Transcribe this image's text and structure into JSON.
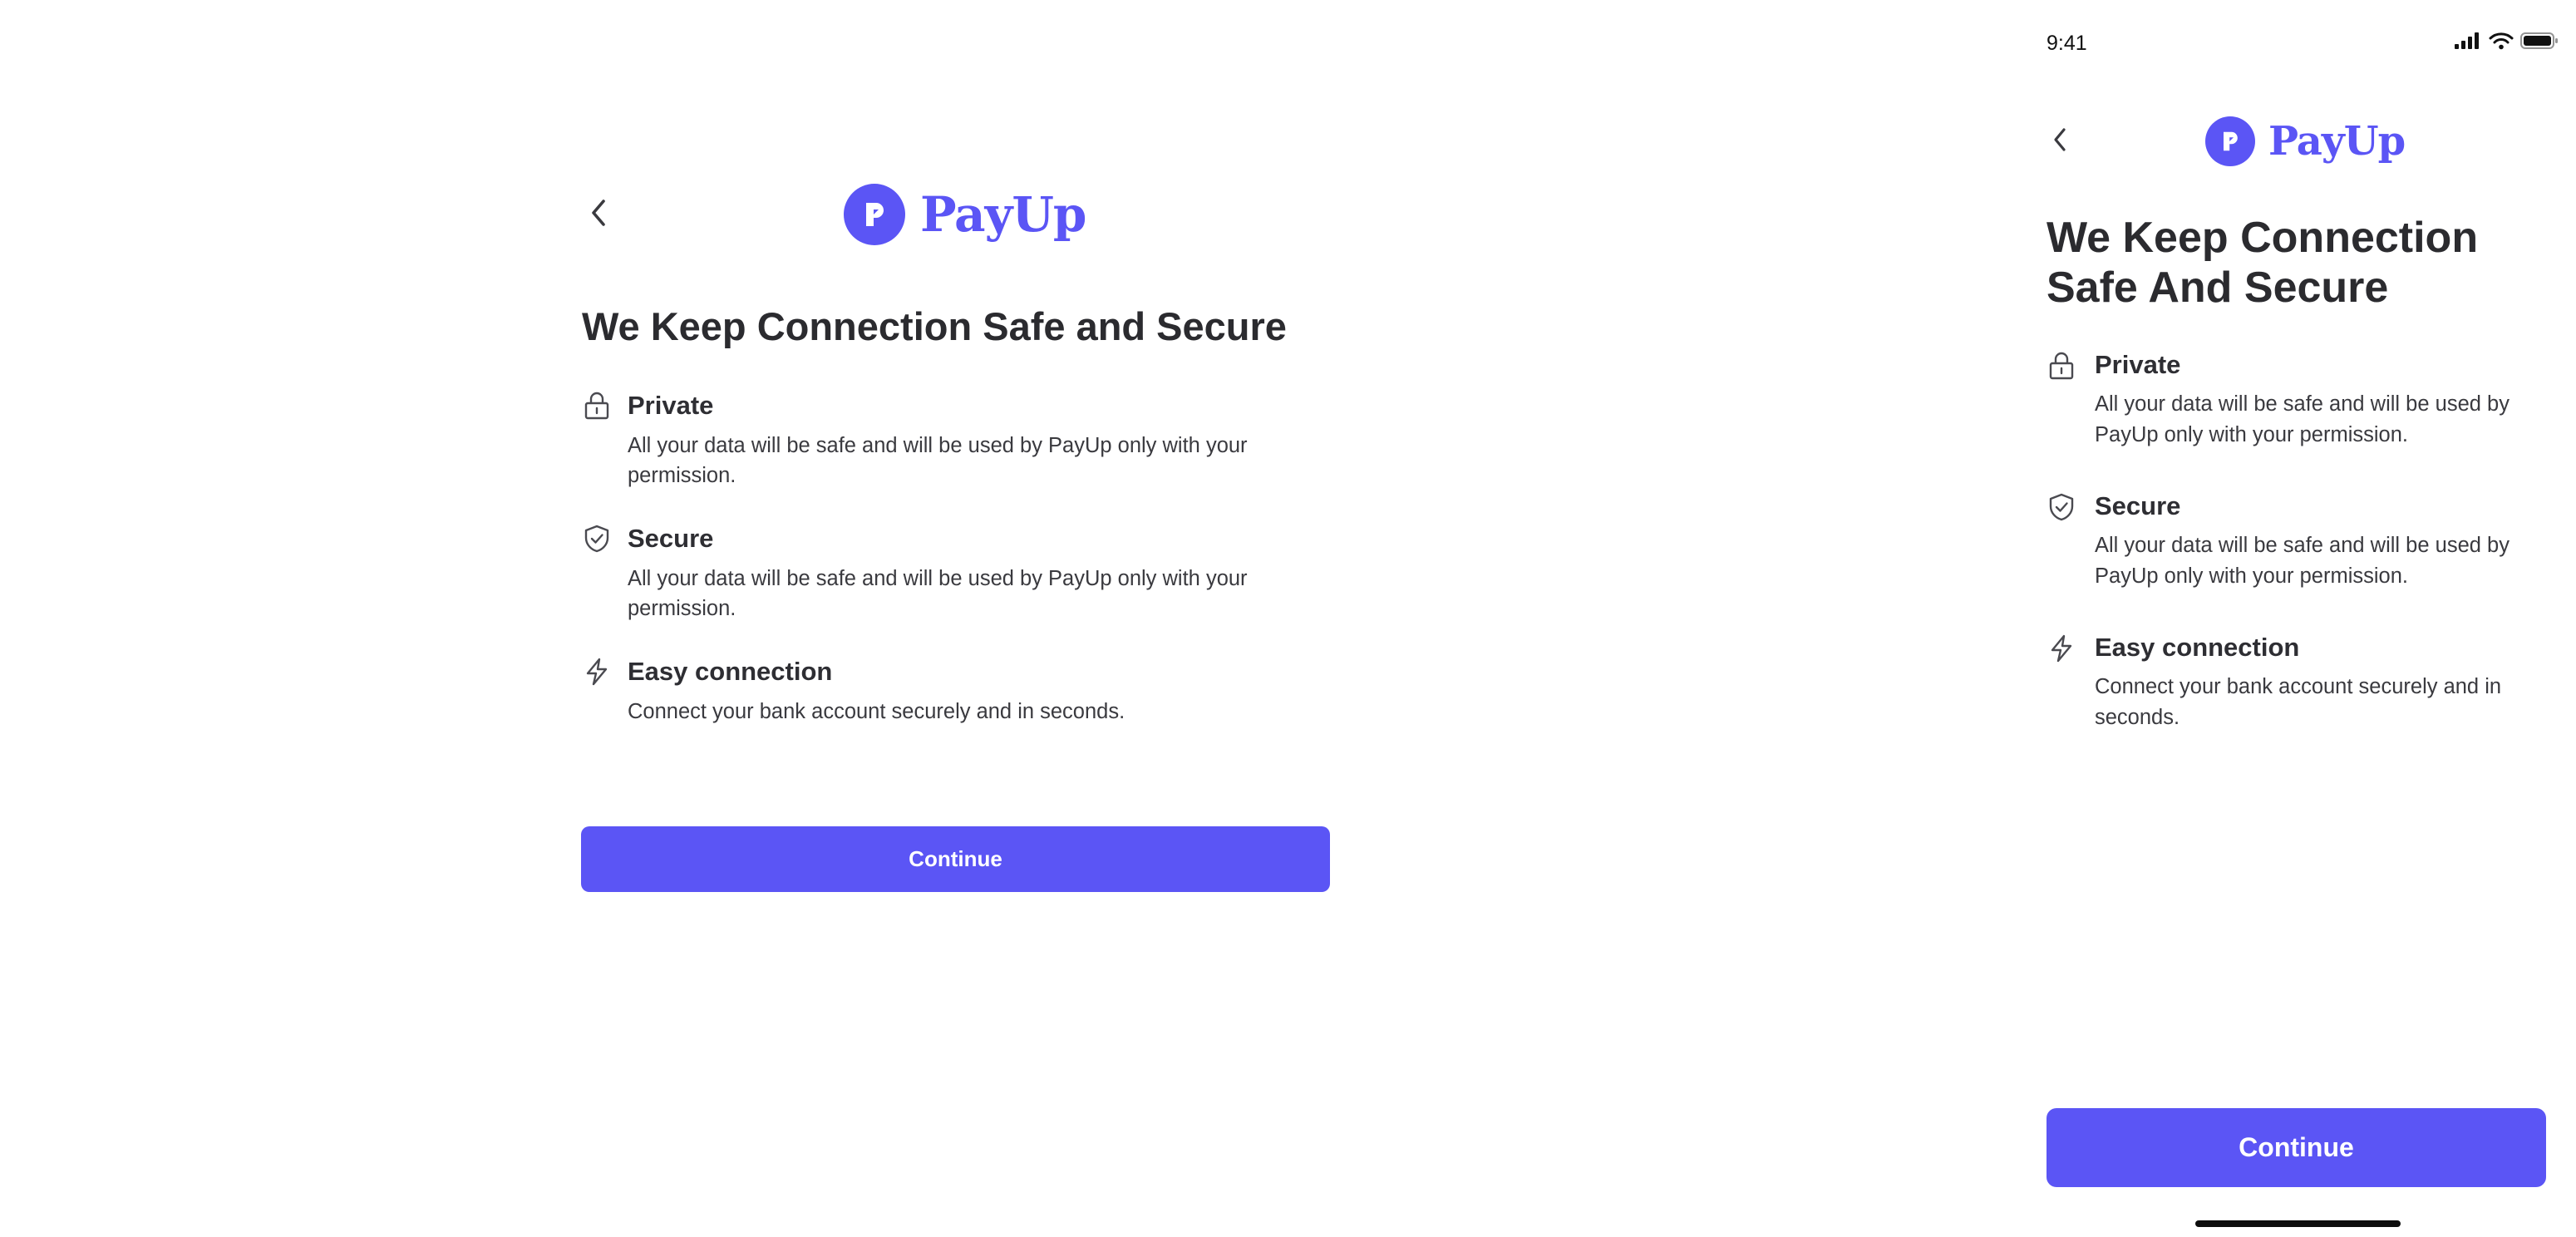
{
  "colors": {
    "accent": "#5b55f5",
    "text": "#2b2b2f",
    "icon_stroke": "#4a4a50",
    "button_text": "#ffffff"
  },
  "brand": {
    "name": "PayUp",
    "logo_icon": "payup-logo-icon"
  },
  "desktop": {
    "back_icon": "chevron-left-icon",
    "headline": "We Keep Connection Safe and Secure",
    "features": [
      {
        "icon": "lock-icon",
        "title": "Private",
        "description": "All your data will be safe and will be used by PayUp only with your permission."
      },
      {
        "icon": "shield-check-icon",
        "title": "Secure",
        "description": "All your data will be safe and will be used by PayUp only with your permission."
      },
      {
        "icon": "lightning-icon",
        "title": "Easy connection",
        "description": "Connect your bank account securely and in seconds."
      }
    ],
    "cta_label": "Continue"
  },
  "mobile": {
    "status_bar": {
      "time": "9:41",
      "icons": [
        "cellular-signal-icon",
        "wifi-icon",
        "battery-icon"
      ]
    },
    "back_icon": "chevron-left-icon",
    "headline": "We Keep Connection Safe And Secure",
    "features": [
      {
        "icon": "lock-icon",
        "title": "Private",
        "description": "All your data will be safe and will be used by PayUp only with your permission."
      },
      {
        "icon": "shield-check-icon",
        "title": "Secure",
        "description": "All your data will be safe and will be used by PayUp only with your permission."
      },
      {
        "icon": "lightning-icon",
        "title": "Easy connection",
        "description": "Connect your bank account securely and in seconds."
      }
    ],
    "cta_label": "Continue"
  }
}
